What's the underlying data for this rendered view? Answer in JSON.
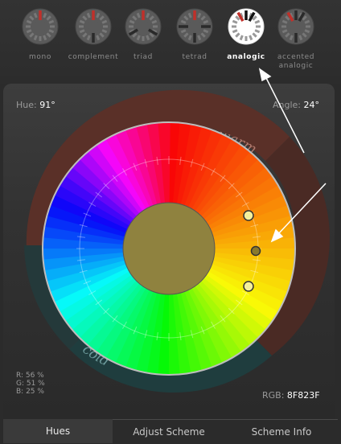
{
  "modes": [
    {
      "label": "mono",
      "icon": "mono-scheme-icon",
      "active": false
    },
    {
      "label": "complement",
      "icon": "complement-scheme-icon",
      "active": false
    },
    {
      "label": "triad",
      "icon": "triad-scheme-icon",
      "active": false
    },
    {
      "label": "tetrad",
      "icon": "tetrad-scheme-icon",
      "active": false
    },
    {
      "label": "analogic",
      "icon": "analogic-scheme-icon",
      "active": true
    },
    {
      "label": "accented\nanalogic",
      "icon": "accented-analogic-scheme-icon",
      "active": false
    }
  ],
  "wheel": {
    "hue_label": "Hue:",
    "hue_value": "91°",
    "angle_label": "Angle:",
    "angle_value": "24°",
    "warm_label": "warm",
    "cold_label": "cold",
    "center_color": "#8F823F"
  },
  "rgb": {
    "r": "R: 56 %",
    "g": "G: 51 %",
    "b": "B: 25 %",
    "hex_label": "RGB:",
    "hex_value": "8F823F"
  },
  "tabs": {
    "hues": "Hues",
    "adjust": "Adjust Scheme",
    "info": "Scheme Info"
  }
}
